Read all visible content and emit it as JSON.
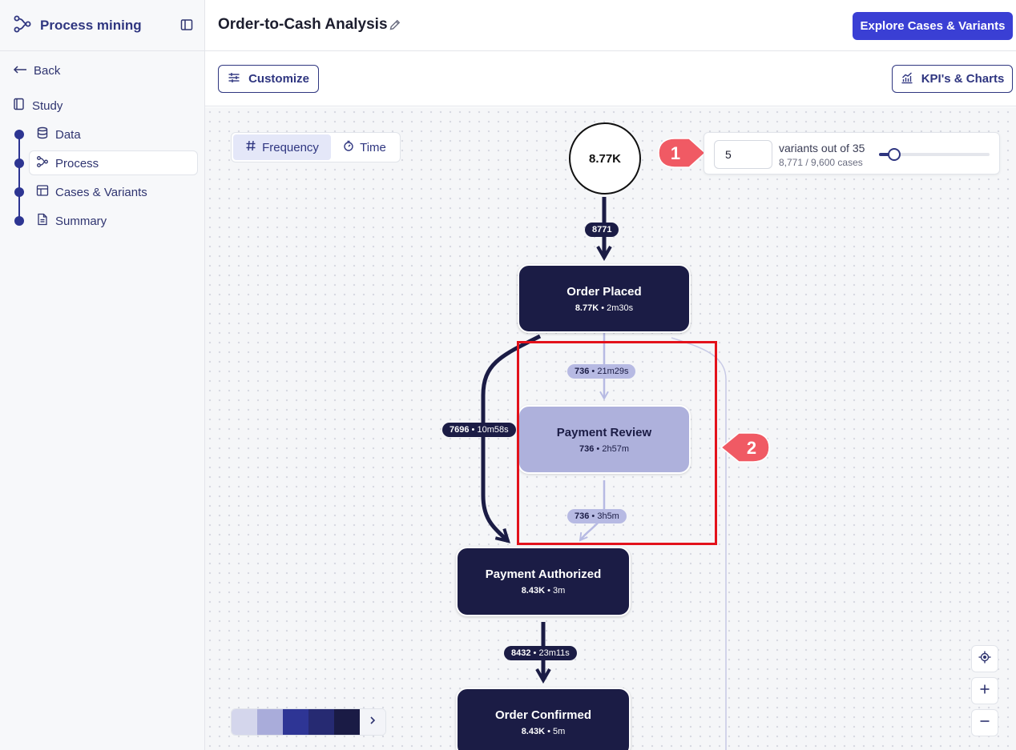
{
  "sidebar": {
    "brand": "Process mining",
    "back": "Back",
    "section": "Study",
    "steps": [
      {
        "label": "Data",
        "icon": "database-icon"
      },
      {
        "label": "Process",
        "icon": "process-icon"
      },
      {
        "label": "Cases & Variants",
        "icon": "table-icon"
      },
      {
        "label": "Summary",
        "icon": "document-icon"
      }
    ],
    "active_step": "Process"
  },
  "header": {
    "title": "Order-to-Cash Analysis",
    "primary_button": "Explore Cases & Variants"
  },
  "toolbar": {
    "customize": "Customize",
    "kpis": "KPI's & Charts"
  },
  "canvas": {
    "metric_toggle": {
      "frequency": "Frequency",
      "time": "Time",
      "selected": "Frequency"
    },
    "start_node": "8.77K",
    "variants": {
      "value": "5",
      "label": "variants out of 35",
      "cases": "8,771 / 9,600 cases",
      "slider_fraction": 0.14
    },
    "nodes": [
      {
        "title": "Order Placed",
        "count": "8.77K",
        "time": "2m30s"
      },
      {
        "title": "Payment Review",
        "count": "736",
        "time": "2h57m"
      },
      {
        "title": "Payment Authorized",
        "count": "8.43K",
        "time": "3m"
      },
      {
        "title": "Order Confirmed",
        "count": "8.43K",
        "time": "5m"
      }
    ],
    "edges": [
      {
        "count": "8771",
        "time": ""
      },
      {
        "count": "736",
        "time": "21m29s"
      },
      {
        "count": "7696",
        "time": "10m58s"
      },
      {
        "count": "736",
        "time": "3h5m"
      },
      {
        "count": "8432",
        "time": "23m11s"
      }
    ],
    "callouts": [
      "1",
      "2"
    ],
    "legend_colors": [
      "#d4d6ec",
      "#a9acda",
      "#2e3595",
      "#262a72",
      "#1a1b45"
    ],
    "colors": {
      "accent": "#3a3fd4",
      "brand": "#2f3680",
      "highlight": "#e3121b",
      "callout": "#f05a64"
    }
  }
}
